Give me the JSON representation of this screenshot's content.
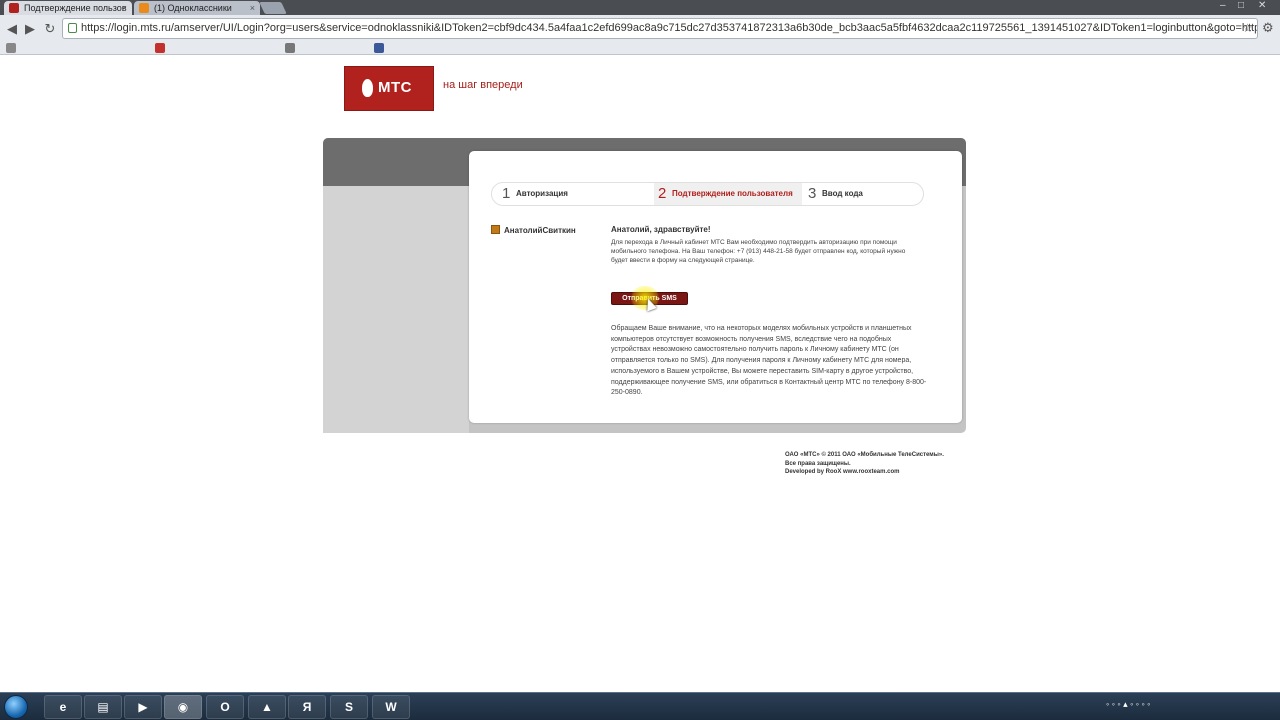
{
  "browser": {
    "tabs": [
      {
        "label": "Подтверждение пользов",
        "active": true
      },
      {
        "label": "(1) Одноклассники",
        "active": false
      }
    ],
    "url": "https://login.mts.ru/amserver/UI/Login?org=users&service=odnoklassniki&IDToken2=cbf9dc434.5a4faa1c2efd699ac8a9c715dc27d353741872313a6b30de_bcb3aac5a5fbf4632dcaa2c119725561_1391451027&IDToken1=loginbutton&goto=https://"
  },
  "header": {
    "logo_text": "МТС",
    "slogan": "на шаг впереди"
  },
  "steps": [
    {
      "num": "1",
      "label": "Авторизация"
    },
    {
      "num": "2",
      "label": "Подтверждение пользователя"
    },
    {
      "num": "3",
      "label": "Ввод кода"
    }
  ],
  "user": {
    "name": "АнатолийСвиткин"
  },
  "content": {
    "greeting": "Анатолий, здравствуйте!",
    "intro": "Для перехода в Личный кабинет МТС Вам необходимо подтвердить авторизацию при помощи мобильного телефона. На Ваш телефон: +7 (913) 448-21-58 будет отправлен код, который нужно будет ввести в форму на следующей странице.",
    "send_button": "Отправить SMS",
    "notice": "Обращаем Ваше внимание, что на некоторых моделях мобильных устройств и планшетных компьютеров отсутствует возможность получения SMS, вследствие чего на подобных устройствах невозможно самостоятельно получить пароль к Личному кабинету МТС (он отправляется только по SMS). Для получения пароля к Личному кабинету МТС для номера, используемого в Вашем устройстве, Вы можете переставить SIM-карту в другое устройство, поддерживающее получение SMS, или обратиться в Контактный центр МТС по телефону 8-800-250-0890."
  },
  "footer": {
    "line1": "ОАО «МТС» © 2011 ОАО «Мобильные ТелеСистемы».",
    "line2": "Все права защищены.",
    "line3": "Developed by RooX www.rooxteam.com"
  },
  "colors": {
    "brand_red": "#b1221f",
    "button_dark_red": "#7a1614"
  }
}
